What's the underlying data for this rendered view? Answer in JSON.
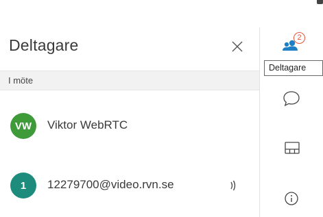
{
  "panel": {
    "title": "Deltagare",
    "section_label": "I möte",
    "participants": [
      {
        "initials": "VW",
        "name": "Viktor WebRTC",
        "avatar_color": "#3f9a3a"
      },
      {
        "initials": "1",
        "name": "12279700@video.rvn.se",
        "avatar_color": "#1e8c7d"
      }
    ]
  },
  "rail": {
    "participants_badge": "2",
    "tooltip": "Deltagare",
    "icons": [
      "participants-icon",
      "chat-icon",
      "layout-icon",
      "info-icon"
    ]
  },
  "colors": {
    "accent_blue": "#1f7fc4",
    "badge_red": "#e5533d",
    "section_bg": "#f2f2f2"
  }
}
